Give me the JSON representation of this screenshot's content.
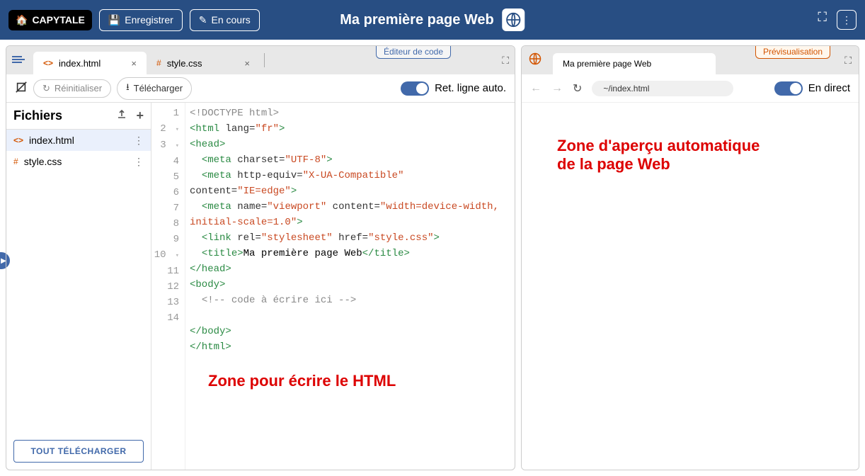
{
  "header": {
    "logo": "CAPYTALE",
    "save_label": "Enregistrer",
    "status_label": "En cours",
    "title": "Ma première page Web",
    "badge": "Web"
  },
  "editor": {
    "panel_label": "Éditeur de code",
    "tabs": [
      {
        "name": "index.html",
        "active": true
      },
      {
        "name": "style.css",
        "active": false
      }
    ],
    "reset_label": "Réinitialiser",
    "download_label": "Télécharger",
    "autowrap_label": "Ret. ligne auto."
  },
  "sidebar": {
    "title": "Fichiers",
    "files": [
      {
        "name": "index.html",
        "active": true,
        "type": "html"
      },
      {
        "name": "style.css",
        "active": false,
        "type": "css"
      }
    ],
    "download_all": "TOUT TÉLÉCHARGER"
  },
  "code": {
    "lines": 14,
    "annotation": "Zone pour écrire le HTML"
  },
  "preview": {
    "panel_label": "Prévisualisation",
    "tab_title": "Ma première page Web",
    "url": "~/index.html",
    "live_label": "En direct",
    "annotation_line1": "Zone d'aperçu automatique",
    "annotation_line2": "de la page Web"
  }
}
